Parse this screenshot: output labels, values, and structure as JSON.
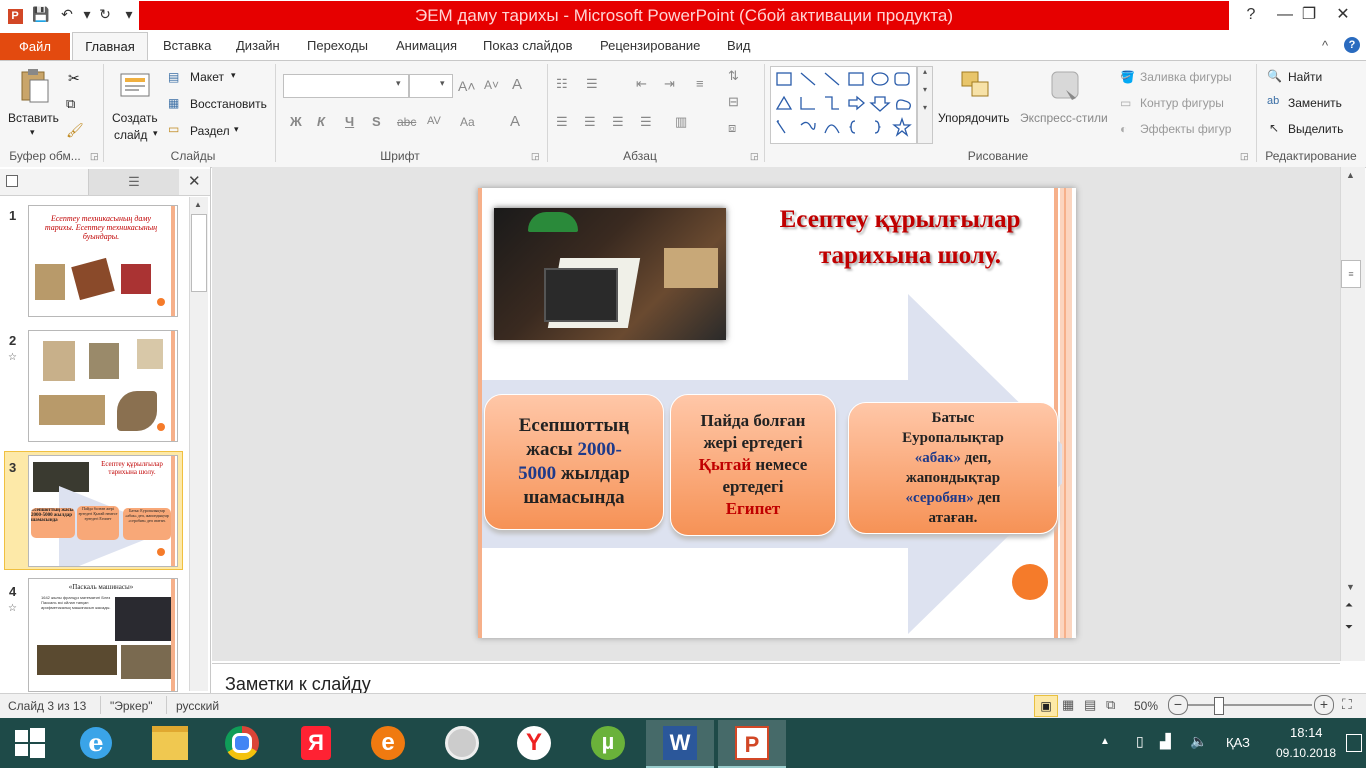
{
  "window": {
    "title": "ЭЕМ даму тарихы  -  Microsoft PowerPoint (Сбой активации продукта)",
    "controls": [
      "?",
      "—",
      "❐",
      "✕"
    ]
  },
  "tabs": {
    "file": "Файл",
    "items": [
      "Главная",
      "Вставка",
      "Дизайн",
      "Переходы",
      "Анимация",
      "Показ слайдов",
      "Рецензирование",
      "Вид"
    ]
  },
  "ribbon": {
    "clipboard": {
      "paste": "Вставить",
      "label": "Буфер обм..."
    },
    "slides": {
      "new_slide_line1": "Создать",
      "new_slide_line2": "слайд",
      "layout": "Макет",
      "reset": "Восстановить",
      "section": "Раздел",
      "label": "Слайды"
    },
    "font": {
      "label": "Шрифт",
      "bold": "Ж",
      "italic": "К",
      "underline": "Ч",
      "shadow": "S",
      "strike": "abc",
      "spacing": "AV",
      "case": "Aa",
      "color": "A",
      "grow": "A˄",
      "shrink": "A˅",
      "clear": "A"
    },
    "paragraph": {
      "label": "Абзац"
    },
    "drawing": {
      "arrange": "Упорядочить",
      "quick_styles": "Экспресс-стили",
      "fill": "Заливка фигуры",
      "outline": "Контур фигуры",
      "effects": "Эффекты фигур",
      "label": "Рисование"
    },
    "editing": {
      "find": "Найти",
      "replace": "Заменить",
      "select": "Выделить",
      "label": "Редактирование"
    }
  },
  "thumbnails": [
    {
      "num": "1",
      "text": "Есептеу техникасының  даму тарихы. Есептеу техникасының  буындары."
    },
    {
      "num": "2",
      "text": ""
    },
    {
      "num": "3",
      "title": "Есептеу  құрылғылар тарихына  шолу.",
      "b1": "Есепшоттың жасы 2000-5000 жылдар шамасында",
      "b2": "Пайда болған жері ертедегі Қытай немесе ертедегі Египет",
      "b3": "Батыс Еуропалықтар «абак» деп, жапондықтар «серобян» деп атаған."
    },
    {
      "num": "4",
      "title": "«Паскаль  машинасы»",
      "text": "1642 жылы француз математигі Блез Паскаль өзі ойлап тапқан арифметикалық машинасын жасады."
    }
  ],
  "slide": {
    "title_line1": "Есептеу  құрылғылар",
    "title_line2": "тарихына  шолу.",
    "box1": {
      "a": "Есепшоттың",
      "b": "жасы ",
      "c": "2000-",
      "d": "5000",
      "e": " жылдар",
      "f": "шамасында"
    },
    "box2": {
      "a": "Пайда болған",
      "b": "жері ертедегі",
      "c": "Қытай",
      "d": " немесе",
      "e": "ертедегі",
      "f": "Египет"
    },
    "box3": {
      "a": "Батыс",
      "b": "Еуропалықтар",
      "c": "«абак»",
      "d": " деп,",
      "e": "жапондықтар",
      "f": "«серобян»",
      "g": " деп",
      "h": "атаған."
    },
    "colors": {
      "title": "#c00000",
      "number": "#1f3a8a",
      "accent": "#c00000",
      "box": "#f69256",
      "arrow": "#d9dff0"
    }
  },
  "notes": {
    "placeholder": "Заметки к слайду"
  },
  "status": {
    "slide_info": "Слайд 3 из 13",
    "theme": "\"Эркер\"",
    "language": "русский",
    "zoom": "50%"
  },
  "taskbar": {
    "lang": "ҚАЗ",
    "time": "18:14",
    "date": "09.10.2018"
  }
}
